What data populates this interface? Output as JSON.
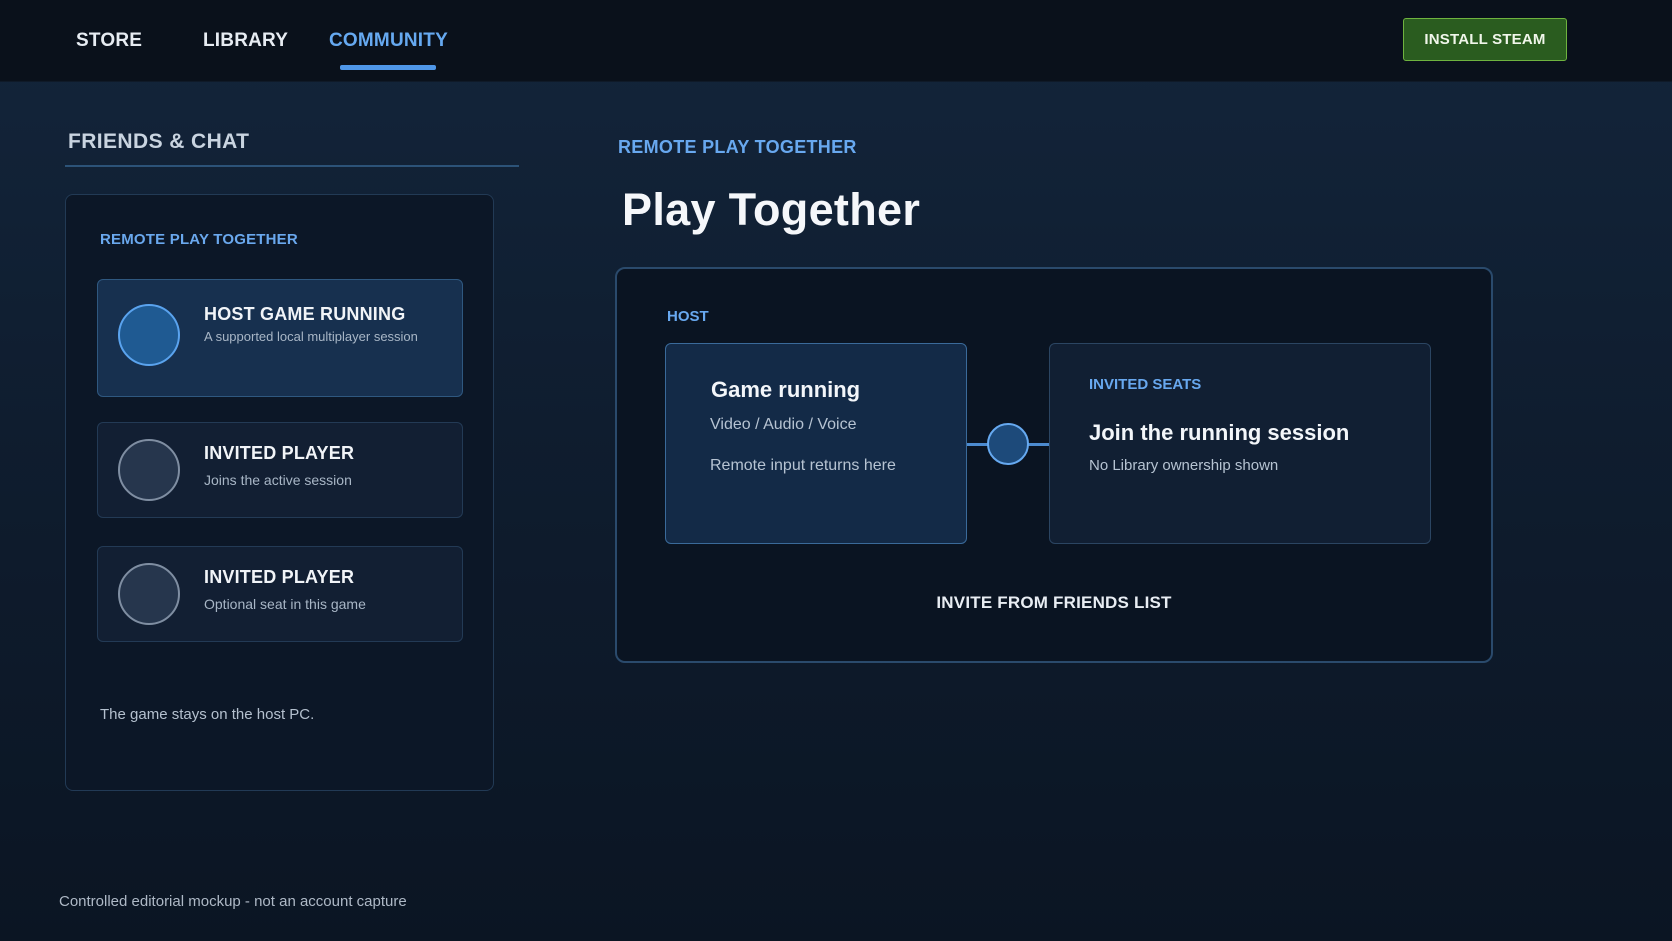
{
  "nav": {
    "tabs": [
      {
        "label": "STORE"
      },
      {
        "label": "LIBRARY"
      },
      {
        "label": "COMMUNITY"
      }
    ],
    "active_tab": "COMMUNITY",
    "install_label": "INSTALL STEAM"
  },
  "friends": {
    "section_title": "FRIENDS & CHAT",
    "panel_title": "REMOTE PLAY TOGETHER",
    "players": [
      {
        "title": "HOST GAME RUNNING",
        "subtitle": "A supported local multiplayer session"
      },
      {
        "title": "INVITED PLAYER",
        "subtitle": "Joins the active session"
      },
      {
        "title": "INVITED PLAYER",
        "subtitle": "Optional seat in this game"
      }
    ],
    "footnote": "The game stays on the host PC."
  },
  "main": {
    "eyebrow": "REMOTE PLAY TOGETHER",
    "title": "Play Together",
    "host_label": "HOST",
    "host_box": {
      "title": "Game running",
      "line1": "Video / Audio / Voice",
      "line2": "Remote input returns here"
    },
    "seats_box": {
      "label": "INVITED SEATS",
      "title": "Join the running session",
      "subtitle": "No Library ownership shown"
    },
    "invite_label": "INVITE FROM FRIENDS LIST"
  },
  "footer": {
    "note": "Controlled editorial mockup - not an account capture"
  },
  "colors": {
    "accent": "#66a9f0",
    "install_button": "#2a5c1f",
    "background": "#0b1421"
  }
}
